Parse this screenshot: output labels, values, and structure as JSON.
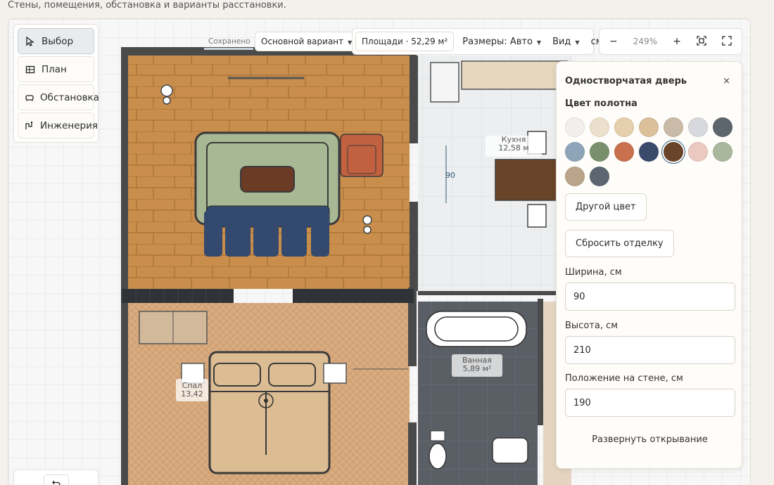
{
  "page": {
    "subtitle": "Стены, помещения, обстановка и варианты расстановки."
  },
  "tools": [
    {
      "label": "Выбор",
      "icon": "cursor-icon"
    },
    {
      "label": "План",
      "icon": "plan-icon"
    },
    {
      "label": "Обстановка",
      "icon": "sofa-icon"
    },
    {
      "label": "Инженерия",
      "icon": "engineering-icon"
    }
  ],
  "toolbar": {
    "saved": "Сохранено",
    "variant": "Основной вариант",
    "area": "Площади · 52,29 м²",
    "sizes": "Размеры: Авто",
    "view": "Вид",
    "units": "см",
    "zoom_out": "−",
    "zoom": "249%",
    "zoom_in": "+"
  },
  "rooms": {
    "kitchen": {
      "name": "Кухня",
      "area": "12,58 м"
    },
    "bath": {
      "name": "Ванная",
      "area": "5,89 м²"
    },
    "bedroom": {
      "name": "Спал",
      "area": "13,42"
    },
    "dimension": "90"
  },
  "panel": {
    "title": "Одностворчатая дверь",
    "close": "×",
    "color_label": "Цвет полотна",
    "colors": [
      "#f2f0ec",
      "#ecdfcb",
      "#e5cfac",
      "#dcc09b",
      "#c9bba7",
      "#d8d9de",
      "#5d656d",
      "#8ea4b8",
      "#78906b",
      "#c9704e",
      "#3a4a6b",
      "#6a4429",
      "#ebc9c0",
      "#a9b89c",
      "#bba58a",
      "#5d6670"
    ],
    "selected_color": "#6a4429",
    "other_color": "Другой цвет",
    "reset_finish": "Сбросить отделку",
    "width_label": "Ширина, см",
    "width_value": "90",
    "height_label": "Высота, см",
    "height_value": "210",
    "position_label": "Положение на стене, см",
    "position_value": "190",
    "flip_opening": "Развернуть открывание"
  }
}
